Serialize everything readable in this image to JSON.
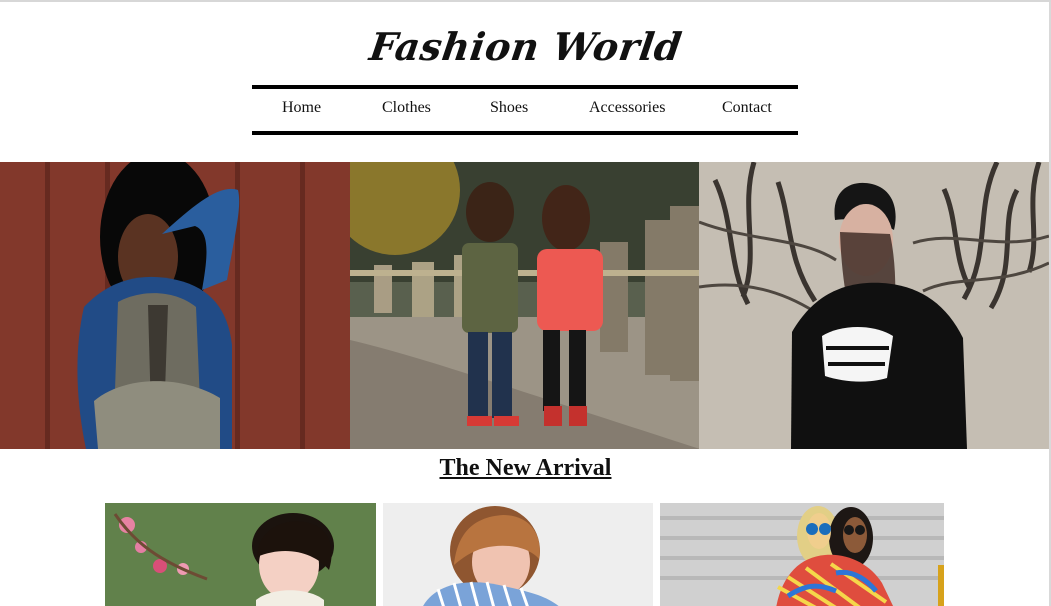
{
  "site": {
    "brand": "Fashion World"
  },
  "nav": {
    "items": [
      {
        "label": "Home"
      },
      {
        "label": "Clothes"
      },
      {
        "label": "Shoes"
      },
      {
        "label": "Accessories"
      },
      {
        "label": "Contact"
      }
    ]
  },
  "hero": {
    "images": [
      {
        "icon": "woman-denim-portrait-image"
      },
      {
        "icon": "children-walking-image"
      },
      {
        "icon": "woman-beanie-sweatshirt-image"
      }
    ]
  },
  "new_arrival": {
    "title": "The New Arrival",
    "cards": [
      {
        "icon": "woman-with-flowers-image"
      },
      {
        "icon": "woman-striped-shirt-image"
      },
      {
        "icon": "two-women-sunglasses-image"
      }
    ]
  },
  "colors": {
    "background": "#ffffff",
    "text": "#111111",
    "nav_border": "#000000"
  }
}
